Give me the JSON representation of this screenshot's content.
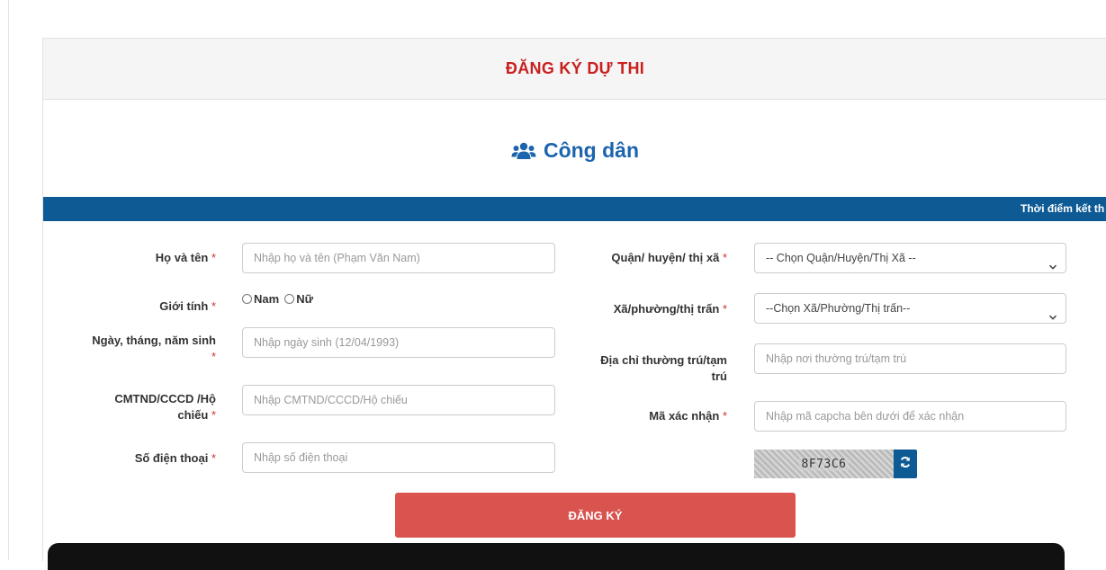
{
  "form": {
    "title": "ĐĂNG KÝ DỰ THI",
    "section_title": "Công dân",
    "notice": "Thời điểm kết th",
    "required_mark": "*",
    "fields": {
      "fullname": {
        "label": "Họ và tên",
        "placeholder": "Nhập họ và tên (Phạm Văn Nam)"
      },
      "gender": {
        "label": "Giới tính",
        "options": [
          "Nam",
          "Nữ"
        ]
      },
      "dob": {
        "label_line1": "Ngày, tháng, năm sinh",
        "placeholder": "Nhập ngày sinh (12/04/1993)"
      },
      "id_number": {
        "label_line1": "CMTND/CCCD /Hộ",
        "label_line2": "chiếu",
        "placeholder": "Nhập CMTND/CCCD/Hộ chiếu"
      },
      "phone": {
        "label": "Số điện thoại",
        "placeholder": "Nhập số điện thoại"
      },
      "district": {
        "label": "Quận/ huyện/ thị xã",
        "selected": "-- Chọn Quận/Huyện/Thị Xã --"
      },
      "ward": {
        "label": "Xã/phường/thị trấn",
        "selected": "--Chọn Xã/Phường/Thị trấn--"
      },
      "address": {
        "label_line1": "Địa chỉ thường trú/tạm",
        "label_line2": "trú",
        "placeholder": "Nhập nơi thường trú/tạm trú"
      },
      "captcha": {
        "label": "Mã xác nhận",
        "placeholder": "Nhập mã capcha bên dưới để xác nhận",
        "code": "8F73C6"
      }
    },
    "submit_label": "ĐĂNG KÝ"
  },
  "colors": {
    "title_red": "#c9201f",
    "section_blue": "#1c64ad",
    "bar_blue": "#0d5a94",
    "button_red": "#d9534f"
  },
  "icons": [
    "users-icon",
    "chevron-down-icon",
    "refresh-icon"
  ]
}
